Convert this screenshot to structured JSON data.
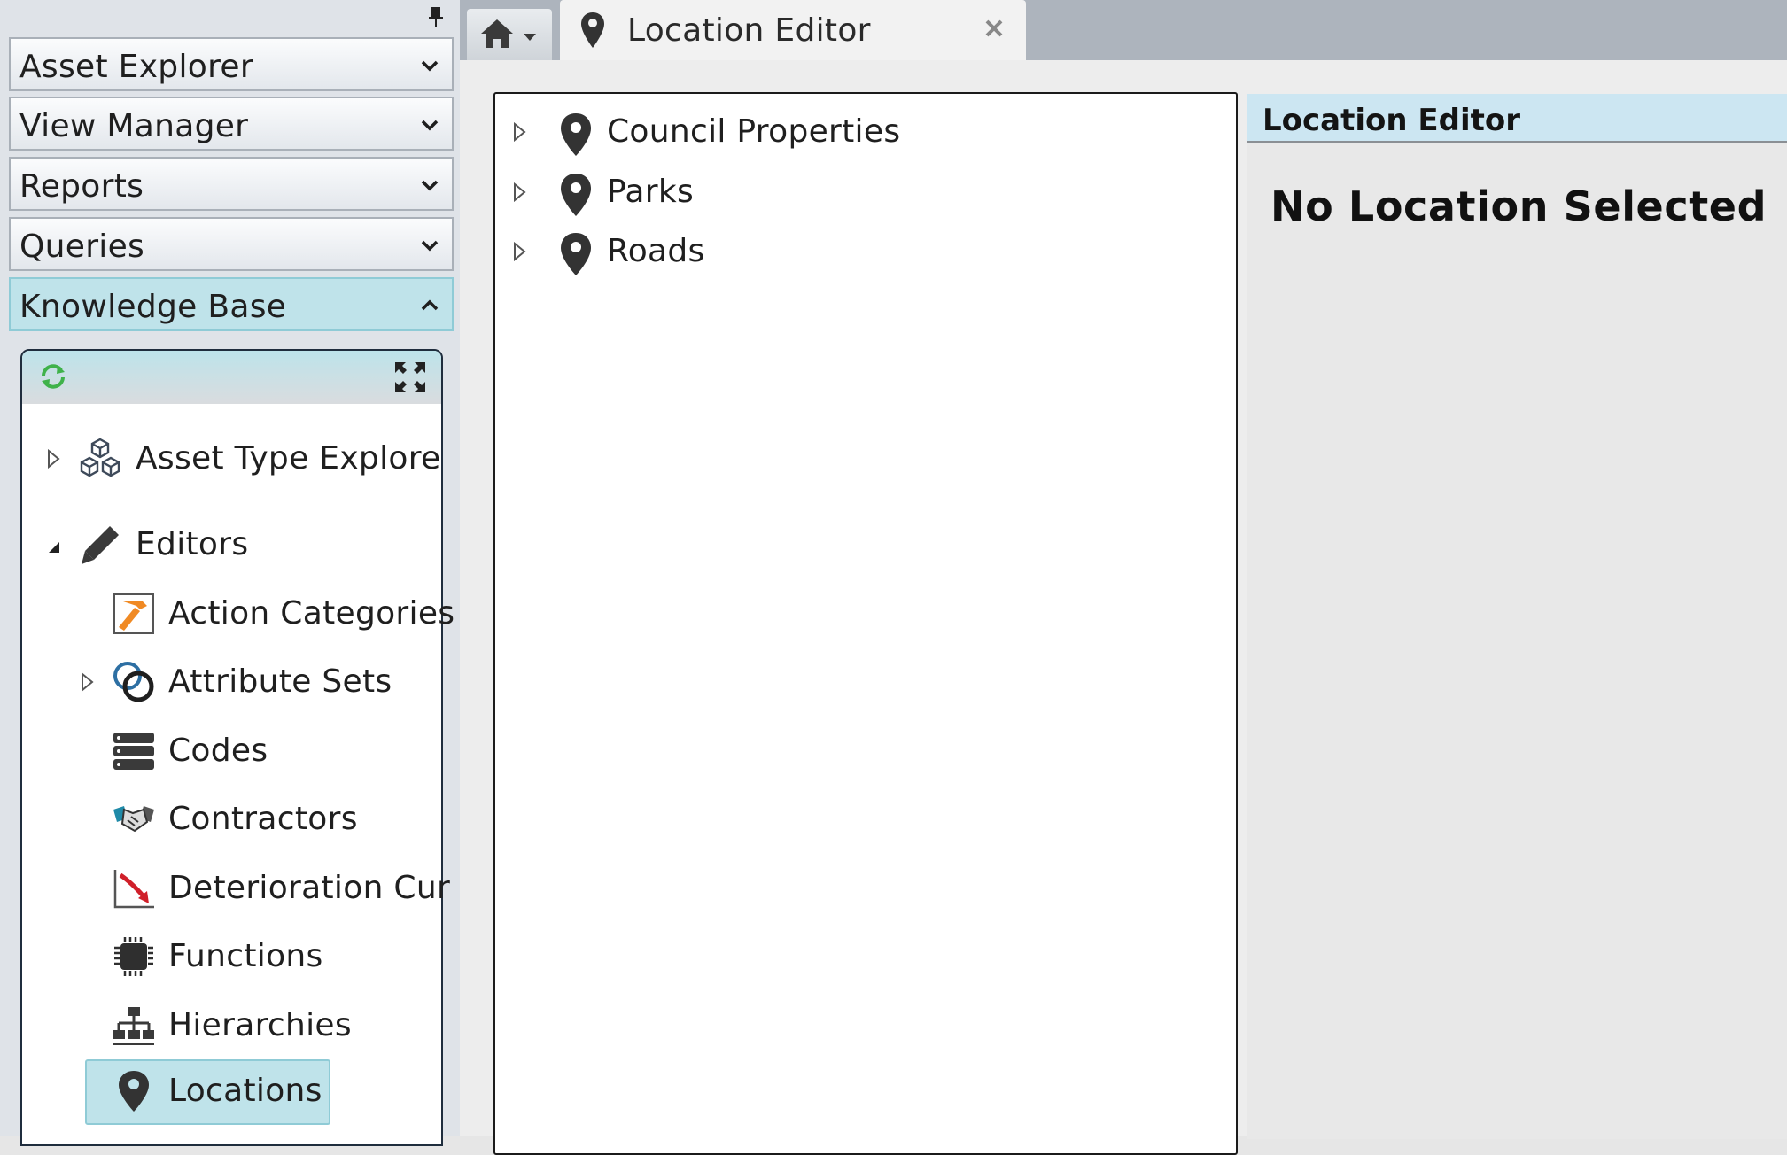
{
  "sidebar": {
    "accordions": [
      {
        "label": "Asset Explorer",
        "expanded": false
      },
      {
        "label": "View Manager",
        "expanded": false
      },
      {
        "label": "Reports",
        "expanded": false
      },
      {
        "label": "Queries",
        "expanded": false
      },
      {
        "label": "Knowledge Base",
        "expanded": true
      }
    ],
    "knowledge_base": {
      "items": [
        {
          "label": "Asset Type Explore",
          "icon": "cubes-icon"
        },
        {
          "label": "Editors",
          "icon": "pencil-icon"
        },
        {
          "label": "Action Categories",
          "icon": "hammer-icon"
        },
        {
          "label": "Attribute Sets",
          "icon": "rings-icon"
        },
        {
          "label": "Codes",
          "icon": "codes-icon"
        },
        {
          "label": "Contractors",
          "icon": "handshake-icon"
        },
        {
          "label": "Deterioration Cur",
          "icon": "curve-icon"
        },
        {
          "label": "Functions",
          "icon": "chip-icon"
        },
        {
          "label": "Hierarchies",
          "icon": "hierarchy-icon"
        },
        {
          "label": "Locations",
          "icon": "map-pin-icon",
          "selected": true
        }
      ]
    }
  },
  "tabs": {
    "active": {
      "label": "Location Editor"
    }
  },
  "location_tree": {
    "items": [
      {
        "label": "Council Properties"
      },
      {
        "label": "Parks"
      },
      {
        "label": "Roads"
      }
    ]
  },
  "editor": {
    "header": "Location Editor",
    "empty_message": "No Location Selected"
  },
  "colors": {
    "selection": "#bfe3ea",
    "header_bg": "#cce6f2",
    "icon_dark": "#3a3a3a",
    "hammer_orange": "#f08a24",
    "curve_red": "#d0202a",
    "refresh_green": "#3fb24a"
  }
}
